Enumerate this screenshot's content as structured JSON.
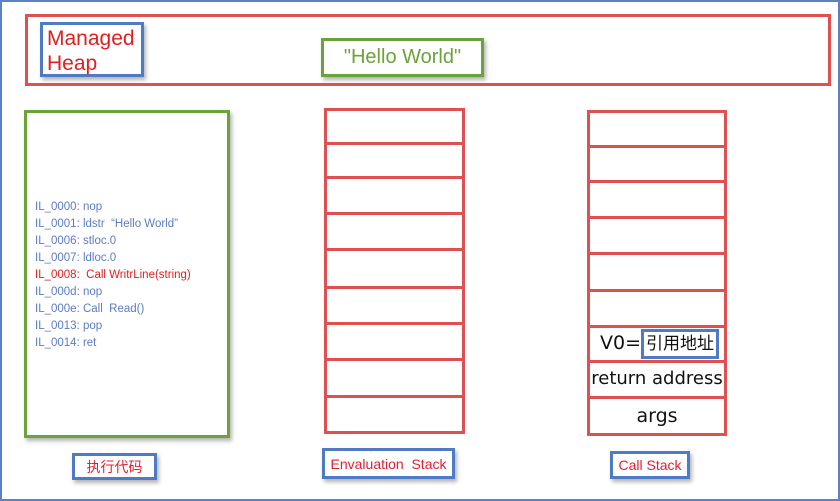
{
  "heap": {
    "title": "Managed Heap",
    "string_object": "\"Hello World\""
  },
  "code": {
    "lines": [
      {
        "text": "IL_0000: nop",
        "highlight": false
      },
      {
        "text": "IL_0001: ldstr  “Hello World”",
        "highlight": false
      },
      {
        "text": "IL_0006: stloc.0",
        "highlight": false
      },
      {
        "text": "IL_0007: ldloc.0",
        "highlight": false
      },
      {
        "text": "IL_0008:  Call WritrLine(string)",
        "highlight": true
      },
      {
        "text": "IL_000d: nop",
        "highlight": false
      },
      {
        "text": "IL_000e: Call  Read()",
        "highlight": false
      },
      {
        "text": "IL_0013: pop",
        "highlight": false
      },
      {
        "text": "IL_0014: ret",
        "highlight": false
      }
    ],
    "label": "执行代码"
  },
  "eval_stack": {
    "label": "Envaluation  Stack"
  },
  "call_stack": {
    "label": "Call Stack",
    "v0_prefix": "V0=",
    "v0_ref": "引用地址",
    "return_address": "return address",
    "args": "args"
  },
  "colors": {
    "heap_border": "#e05050",
    "box_blue": "#4f7ac4",
    "box_green": "#6aa33a",
    "label_red": "#e02030"
  }
}
